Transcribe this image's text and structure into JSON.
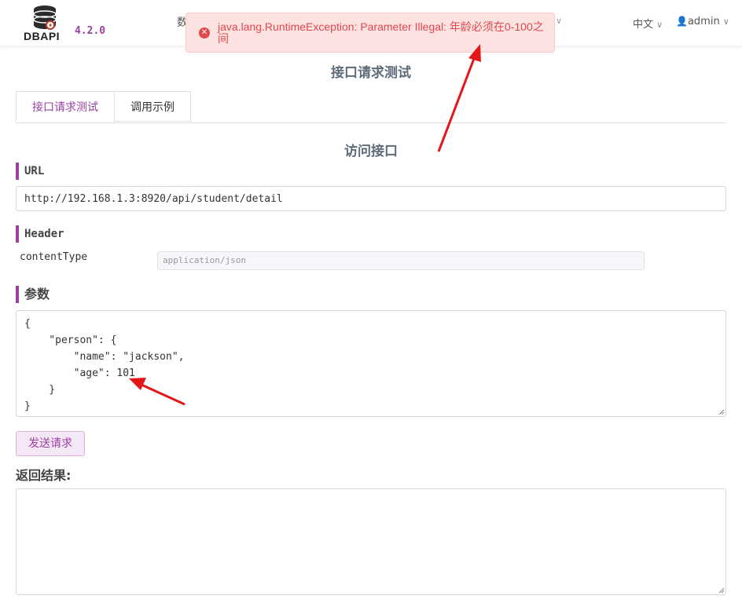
{
  "app": {
    "logo_text": "DBAPI",
    "version": "4.2.0",
    "nav_partial": "数",
    "language": "中文",
    "user": "admin"
  },
  "toast": {
    "message": "java.lang.RuntimeException: Parameter Illegal: 年龄必须在0-100之间",
    "color": "#e0484d"
  },
  "page": {
    "title": "接口请求测试",
    "tabs": [
      {
        "label": "接口请求测试",
        "active": true
      },
      {
        "label": "调用示例",
        "active": false
      }
    ],
    "section_title": "访问接口"
  },
  "url": {
    "label": "URL",
    "value": "http://192.168.1.3:8920/api/student/detail"
  },
  "header": {
    "label": "Header",
    "key": "contentType",
    "value": "application/json"
  },
  "params": {
    "label": "参数",
    "body": "{\n    \"person\": {\n        \"name\": \"jackson\",\n        \"age\": 101\n    }\n}"
  },
  "actions": {
    "send_label": "发送请求"
  },
  "result": {
    "label": "返回结果:",
    "value": ""
  },
  "colors": {
    "accent": "#9b3fa3",
    "annotation_arrow": "#e3161a"
  }
}
